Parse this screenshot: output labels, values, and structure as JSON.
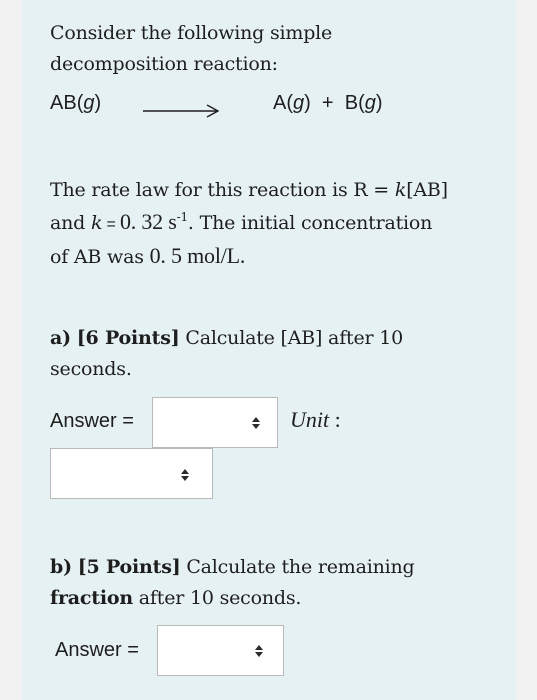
{
  "intro": {
    "line1": "Consider the following simple",
    "line2": "decomposition reaction:"
  },
  "reaction": {
    "reactant": "AB",
    "reactant_state": "g",
    "arrow_icon": "long-right-arrow",
    "product1": "A",
    "product1_state": "g",
    "plus": "+",
    "product2": "B",
    "product2_state": "g"
  },
  "rate_law": {
    "line1_prefix": "The rate law for this reaction is R = ",
    "k_symbol": "k",
    "line1_suffix": "[AB]",
    "line2_prefix": "and ",
    "line2_eq": " = ",
    "k_value": "0. 32",
    "k_unit": " s",
    "k_unit_exp": "-1",
    "line2_suffix": ". The initial concentration",
    "line3_prefix": "of AB was ",
    "initial_conc": "0. 5",
    "line3_suffix": " mol/L."
  },
  "part_a": {
    "label": "a)",
    "points": "[6 Points]",
    "text_line1": " Calculate [AB] after 10",
    "text_line2": "seconds.",
    "answer_label": "Answer =",
    "answer_value": "",
    "unit_label": "Unit",
    "unit_colon": " :",
    "unit_value": ""
  },
  "part_b": {
    "label": "b)",
    "points": "[5 Points]",
    "text_line1": " Calculate the remaining",
    "bold_word": "fraction",
    "text_line2": " after 10 seconds.",
    "answer_label": "Answer =",
    "answer_value": ""
  },
  "colors": {
    "page_bg": "#f3f2f3",
    "panel_bg": "#e6f1f4",
    "text": "#1e1e1e",
    "select_border": "#b9b9b9"
  }
}
